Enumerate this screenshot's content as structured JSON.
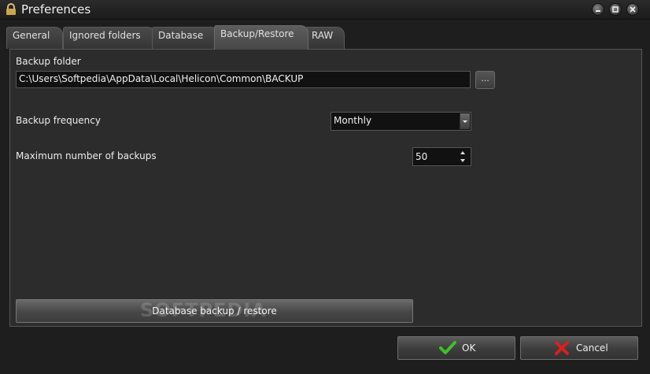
{
  "window": {
    "title": "Preferences",
    "icons": [
      "lock-icon",
      "minimize-icon",
      "maximize-icon",
      "close-icon"
    ]
  },
  "tabs": [
    {
      "label": "General"
    },
    {
      "label": "Ignored folders"
    },
    {
      "label": "Database"
    },
    {
      "label": "Backup/Restore",
      "active": true
    },
    {
      "label": "RAW"
    }
  ],
  "backup": {
    "folder_label": "Backup folder",
    "folder_value": "C:\\Users\\Softpedia\\AppData\\Local\\Helicon\\Common\\BACKUP",
    "browse_label": "...",
    "frequency_label": "Backup frequency",
    "frequency_value": "Monthly",
    "max_label": "Maximum number of backups",
    "max_value": "50",
    "db_button_label": "Database backup / restore",
    "watermark": "SOFTPEDIA"
  },
  "footer": {
    "ok_label": "OK",
    "cancel_label": "Cancel"
  },
  "colors": {
    "ok_check": "#3fbf2a",
    "cancel_x": "#d82020",
    "background": "#2c2c2c"
  }
}
